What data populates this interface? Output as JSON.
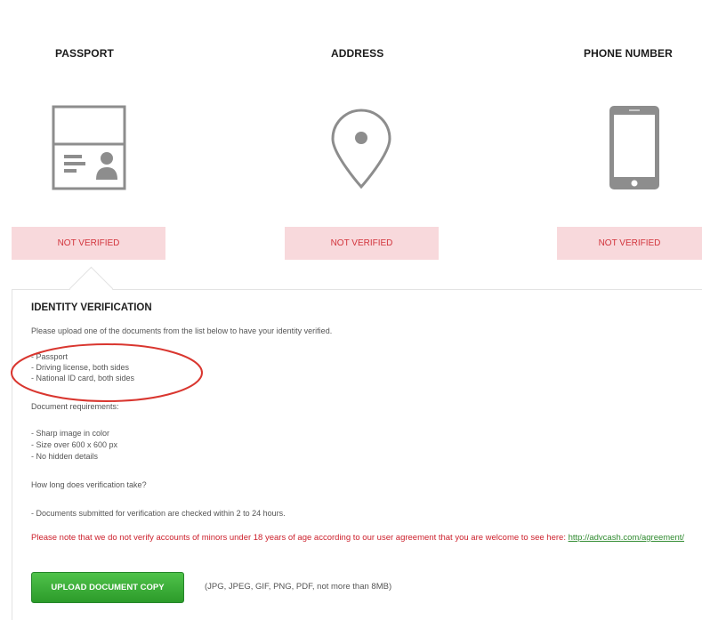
{
  "columns": [
    {
      "title": "PASSPORT",
      "status": "NOT VERIFIED",
      "icon": "passport-icon"
    },
    {
      "title": "ADDRESS",
      "status": "NOT VERIFIED",
      "icon": "location-pin-icon"
    },
    {
      "title": "PHONE NUMBER",
      "status": "NOT VERIFIED",
      "icon": "phone-icon"
    }
  ],
  "panel": {
    "heading": "IDENTITY VERIFICATION",
    "intro": "Please upload one of the documents from the list below to have your identity verified.",
    "documents": [
      "- Passport",
      "- Driving license, both sides",
      "- National ID card, both sides"
    ],
    "requirements_label": "Document requirements:",
    "requirements": [
      "- Sharp image in color",
      "- Size over 600 x 600 px",
      "- No hidden details"
    ],
    "time_question": "How long does verification take?",
    "time_answer": "- Documents submitted for verification are checked within 2 to 24 hours.",
    "warning_text": "Please note that we do not verify accounts of minors under 18 years of age according to our user agreement that you are welcome to see here: ",
    "warning_link": "http://advcash.com/agreement/",
    "upload_button": "UPLOAD DOCUMENT COPY",
    "upload_note": "(JPG, JPEG, GIF, PNG, PDF, not more than 8MB)"
  },
  "colors": {
    "status_bg": "#f8d9dc",
    "status_text": "#d2343c",
    "button_green": "#3cae38",
    "warning_red": "#cc1f2b",
    "annotation_red": "#d9362f"
  }
}
